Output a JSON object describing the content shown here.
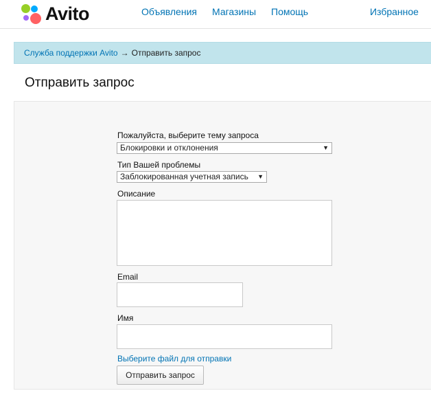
{
  "header": {
    "logo_text": "Avito",
    "nav": {
      "ads": "Объявления",
      "shops": "Магазины",
      "help": "Помощь",
      "favorites": "Избранное"
    }
  },
  "breadcrumb": {
    "link": "Служба поддержки Avito",
    "arrow": "→",
    "current": "Отправить запрос"
  },
  "page": {
    "title": "Отправить запрос"
  },
  "form": {
    "topic_label": "Пожалуйста, выберите тему запроса",
    "topic_value": "Блокировки и отклонения",
    "type_label": "Тип Вашей проблемы",
    "type_value": "Заблокированная учетная запись",
    "description_label": "Описание",
    "description_value": "",
    "email_label": "Email",
    "email_value": "",
    "name_label": "Имя",
    "name_value": "",
    "file_link": "Выберите файл для отправки",
    "submit_label": "Отправить запрос"
  },
  "colors": {
    "link": "#0073b4",
    "breadcrumb_bg": "#c1e4ec",
    "panel_bg": "#f7f7f7",
    "logo_green": "#97cf26",
    "logo_blue": "#00aaff",
    "logo_purple": "#a169f7",
    "logo_red": "#ff6163"
  },
  "icons": {
    "logo": "avito-logo-icon",
    "dropdown": "dropdown-arrow-icon"
  }
}
